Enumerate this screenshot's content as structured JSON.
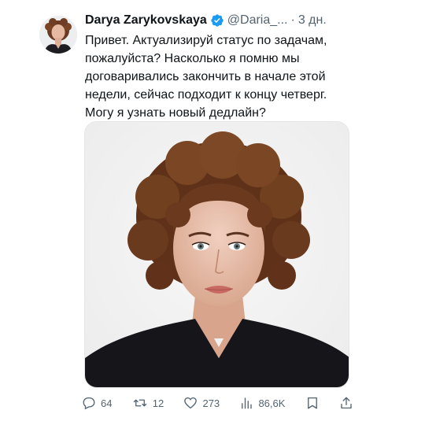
{
  "tweet": {
    "author_name": "Darya Zarykovskaya",
    "handle": "@Daria_...",
    "separator": "·",
    "time": "3 дн.",
    "text": "Привет. Актуализируй статус по задачам,\nпожалуйста? Насколько я помню мы\nдоговаривались закончить в начале этой\nнедели, сейчас подходит к концу четверг.\nМогу я узнать новый дедлайн?",
    "verified_icon": "verified-badge-icon",
    "accent_color": "#1d9bf0"
  },
  "actions": {
    "replies": "64",
    "retweets": "12",
    "likes": "273",
    "views": "86,6K",
    "icons": [
      "reply-icon",
      "retweet-icon",
      "like-icon",
      "views-icon",
      "bookmark-icon",
      "share-icon"
    ]
  }
}
